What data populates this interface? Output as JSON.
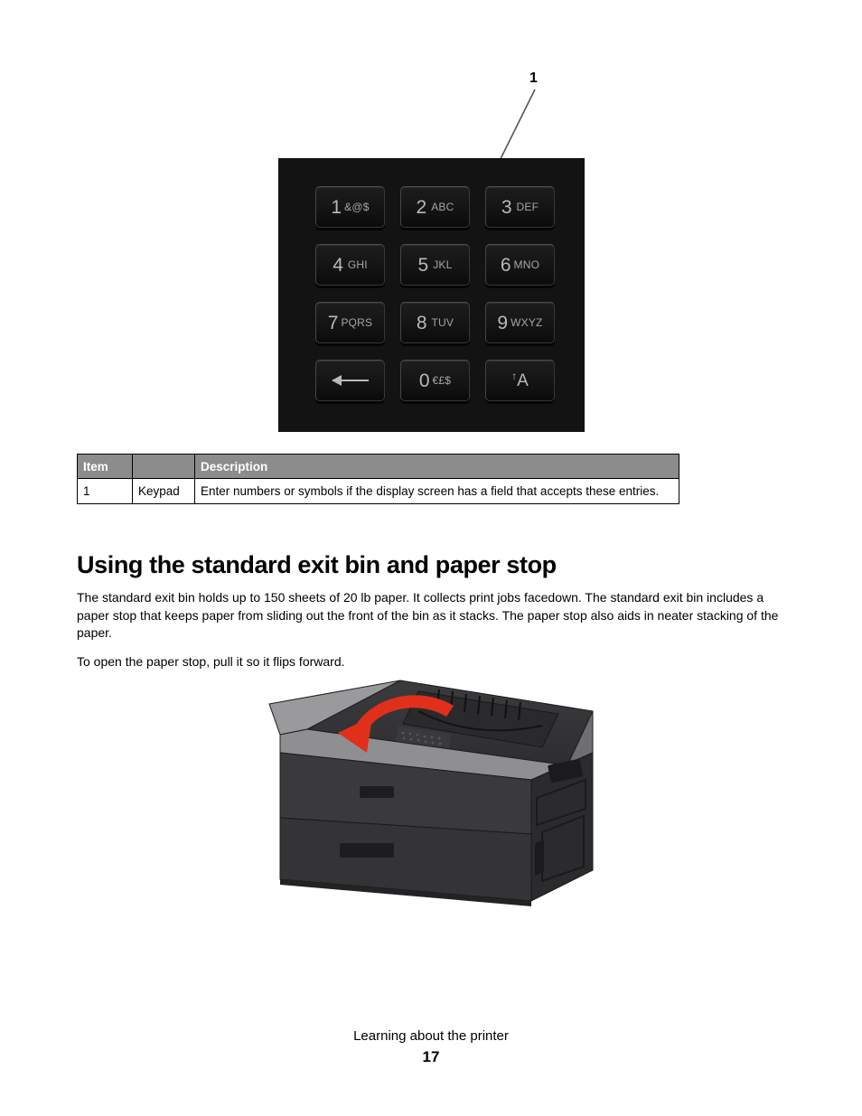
{
  "callout": {
    "number": "1"
  },
  "keypad": {
    "keys": [
      {
        "name": "key-1",
        "digit": "1",
        "letters": "&@$",
        "type": "digit"
      },
      {
        "name": "key-2",
        "digit": "2",
        "letters": "ABC",
        "type": "digit"
      },
      {
        "name": "key-3",
        "digit": "3",
        "letters": "DEF",
        "type": "digit"
      },
      {
        "name": "key-4",
        "digit": "4",
        "letters": "GHI",
        "type": "digit"
      },
      {
        "name": "key-5",
        "digit": "5",
        "letters": "JKL",
        "type": "digit"
      },
      {
        "name": "key-6",
        "digit": "6",
        "letters": "MNO",
        "type": "digit"
      },
      {
        "name": "key-7",
        "digit": "7",
        "letters": "PQRS",
        "type": "digit"
      },
      {
        "name": "key-8",
        "digit": "8",
        "letters": "TUV",
        "type": "digit"
      },
      {
        "name": "key-9",
        "digit": "9",
        "letters": "WXYZ",
        "type": "digit"
      },
      {
        "name": "key-backspace",
        "digit": "",
        "letters": "",
        "type": "backspace",
        "icon": "arrow-left-icon"
      },
      {
        "name": "key-0",
        "digit": "0",
        "letters": "€£$",
        "type": "digit"
      },
      {
        "name": "key-shift",
        "digit": "",
        "letters": "",
        "type": "shift",
        "arrow": "↑",
        "label": "A",
        "icon": "shift-uppercase-icon"
      }
    ]
  },
  "table": {
    "headers": [
      "Item",
      "",
      "Description"
    ],
    "rows": [
      {
        "item": "1",
        "name": "Keypad",
        "description": "Enter numbers or symbols if the display screen has a field that accepts these entries."
      }
    ]
  },
  "section": {
    "heading": "Using the standard exit bin and paper stop",
    "paragraph_1": "The standard exit bin holds up to 150 sheets of 20 lb paper. It collects print jobs facedown. The standard exit bin includes a paper stop that keeps paper from sliding out the front of the bin as it stacks. The paper stop also aids in neater stacking of the paper.",
    "paragraph_2": "To open the paper stop, pull it so it flips forward."
  },
  "illustration": {
    "name": "printer-with-paper-stop-arrow",
    "arrow_color": "#e0301b"
  },
  "footer": {
    "title": "Learning about the printer",
    "page_number": "17"
  }
}
